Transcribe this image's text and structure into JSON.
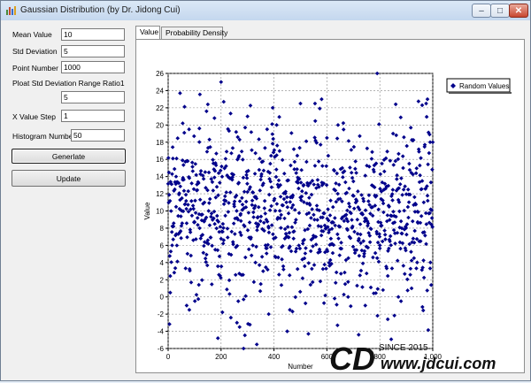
{
  "window": {
    "title": "Gaussian Distribution (by Dr. Jidong Cui)",
    "controls": {
      "minimize": "–",
      "maximize": "□",
      "close": "✕"
    }
  },
  "form": {
    "mean_label": "Mean Value",
    "mean_value": "10",
    "std_label": "Std Deviation",
    "std_value": "5",
    "points_label": "Point Number",
    "points_value": "1000",
    "ratio_label": "Ploat Std Deviation Range Ratio1",
    "ratio_value": "5",
    "xstep_label": "X Value Step",
    "xstep_value": "1",
    "hist_label": "Histogram Number",
    "hist_value": "50",
    "generate_label": "Generlate",
    "update_label": "Update"
  },
  "tabs": [
    {
      "label": "Value",
      "active": true
    },
    {
      "label": "Probability Density",
      "active": false
    }
  ],
  "chart_data": {
    "type": "scatter",
    "title": "",
    "xlabel": "Number",
    "ylabel": "Value",
    "xlim": [
      0,
      1000
    ],
    "ylim": [
      -6,
      26
    ],
    "x_ticks": [
      "0",
      "200",
      "400",
      "600",
      "800",
      "1,000"
    ],
    "y_ticks": [
      "-6",
      "-4",
      "-2",
      "0",
      "2",
      "4",
      "6",
      "8",
      "10",
      "12",
      "14",
      "16",
      "18",
      "20",
      "22",
      "24",
      "26"
    ],
    "grid": true,
    "legend": {
      "position": "right",
      "entries": [
        "Random Values"
      ]
    },
    "series": [
      {
        "name": "Random Values",
        "color": "#00008b",
        "generator": {
          "count": 1000,
          "mean": 10,
          "std": 5,
          "seed": 7
        },
        "points": [
          [
            8,
            0.5
          ],
          [
            15,
            6
          ],
          [
            30,
            14
          ],
          [
            45,
            23.7
          ],
          [
            55,
            20.2
          ],
          [
            70,
            -1
          ],
          [
            80,
            -1.5
          ],
          [
            98,
            18.7
          ],
          [
            118,
            19.6
          ],
          [
            145,
            21.6
          ],
          [
            150,
            22.4
          ],
          [
            175,
            20.8
          ],
          [
            188,
            -4.8
          ],
          [
            200,
            25
          ],
          [
            210,
            22.7
          ],
          [
            230,
            5
          ],
          [
            260,
            -3
          ],
          [
            265,
            -0.5
          ],
          [
            270,
            -3.5
          ],
          [
            285,
            -6
          ],
          [
            300,
            21
          ],
          [
            330,
            4
          ],
          [
            350,
            1.5
          ],
          [
            380,
            -2
          ],
          [
            395,
            22
          ],
          [
            410,
            20
          ],
          [
            450,
            -4
          ],
          [
            460,
            -1.5
          ],
          [
            470,
            -1.7
          ],
          [
            500,
            22.5
          ],
          [
            530,
            -4.3
          ],
          [
            555,
            22.5
          ],
          [
            580,
            23
          ],
          [
            600,
            18.5
          ],
          [
            640,
            -3.3
          ],
          [
            680,
            0
          ],
          [
            720,
            -4.4
          ],
          [
            745,
            -1
          ],
          [
            790,
            26
          ],
          [
            800,
            6
          ],
          [
            830,
            -2.6
          ],
          [
            850,
            19
          ],
          [
            870,
            0
          ],
          [
            880,
            -0.5
          ],
          [
            920,
            1
          ],
          [
            960,
            22.3
          ],
          [
            975,
            22.5
          ],
          [
            980,
            23
          ],
          [
            990,
            18
          ],
          [
            1000,
            18
          ]
        ]
      }
    ]
  },
  "watermark": {
    "logo": "CD",
    "since": "SINCE 2015",
    "url": "www.jdcui.com"
  }
}
